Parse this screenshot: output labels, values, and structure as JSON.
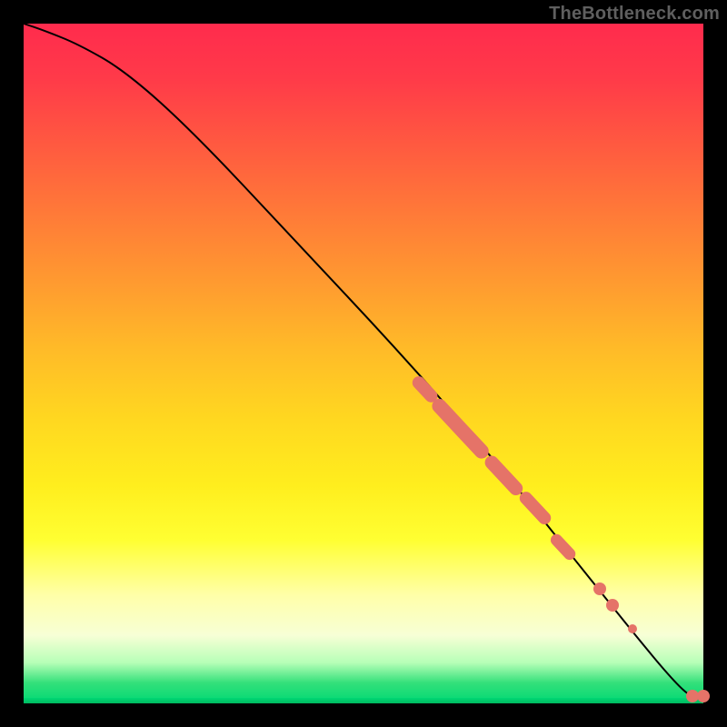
{
  "watermark": "TheBottleneck.com",
  "chart_data": {
    "type": "line",
    "title": "",
    "xlabel": "",
    "ylabel": "",
    "xlim": [
      0,
      100
    ],
    "ylim": [
      0,
      100
    ],
    "curve": {
      "x": [
        0,
        3,
        8,
        15,
        25,
        40,
        55,
        70,
        82,
        90,
        95,
        98,
        100
      ],
      "y": [
        100,
        99,
        97,
        93,
        84,
        68,
        52,
        35,
        20,
        10,
        4,
        1,
        0.5
      ]
    },
    "marker_clusters": [
      {
        "x_start": 58,
        "x_end": 60,
        "y_start": 48,
        "y_end": 46
      },
      {
        "x_start": 61,
        "x_end": 67,
        "y_start": 45,
        "y_end": 38
      },
      {
        "x_start": 68,
        "x_end": 72,
        "y_start": 37,
        "y_end": 32
      },
      {
        "x_start": 73,
        "x_end": 76,
        "y_start": 31,
        "y_end": 27
      },
      {
        "x_start": 78,
        "x_end": 80,
        "y_start": 25,
        "y_end": 22
      }
    ],
    "marker_points": [
      {
        "x": 85,
        "y": 16
      },
      {
        "x": 87,
        "y": 14
      },
      {
        "x": 90,
        "y": 10
      },
      {
        "x": 99,
        "y": 0.8
      },
      {
        "x": 100.5,
        "y": 0.8
      }
    ],
    "marker_color": "#e57368",
    "curve_color": "#000000"
  }
}
